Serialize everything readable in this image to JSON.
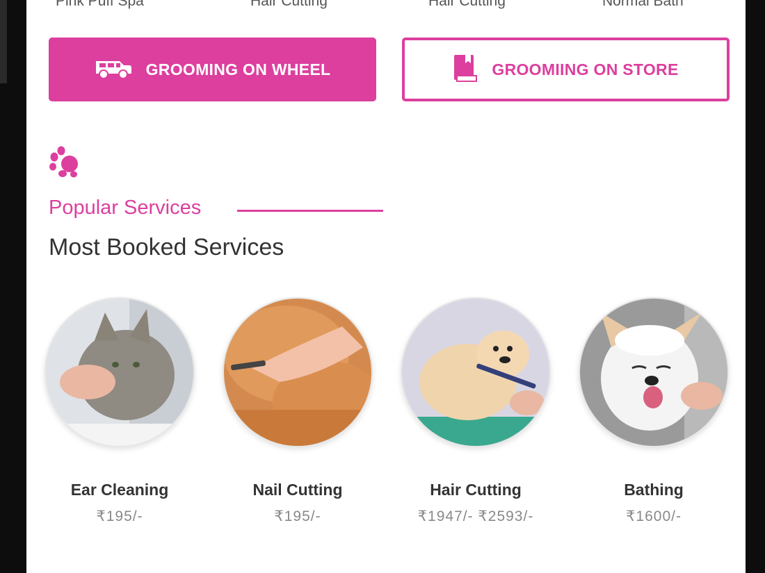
{
  "top_row_labels": [
    "Pink Puff Spa",
    "Hair Cutting",
    "Hair Cutting",
    "Normal Bath"
  ],
  "buttons": {
    "wheel": {
      "label": "GROOMING ON WHEEL",
      "icon": "van-icon"
    },
    "store": {
      "label": "GROOMIING ON STORE",
      "icon": "book-icon"
    }
  },
  "section": {
    "icon": "paw-icon",
    "kicker": "Popular Services",
    "title": "Most Booked Services"
  },
  "services": [
    {
      "name": "Ear Cleaning",
      "price": "₹195/-",
      "image": "cat-ear-cleaning-photo"
    },
    {
      "name": "Nail Cutting",
      "price": "₹195/-",
      "image": "cat-nail-cutting-photo"
    },
    {
      "name": "Hair Cutting",
      "price": "₹1947/- ₹2593/-",
      "image": "pomeranian-hair-cutting-photo"
    },
    {
      "name": "Bathing",
      "price": "₹1600/-",
      "image": "dog-bathing-photo"
    }
  ],
  "colors": {
    "accent": "#dc3f9e",
    "text": "#333333",
    "price": "#888888"
  }
}
